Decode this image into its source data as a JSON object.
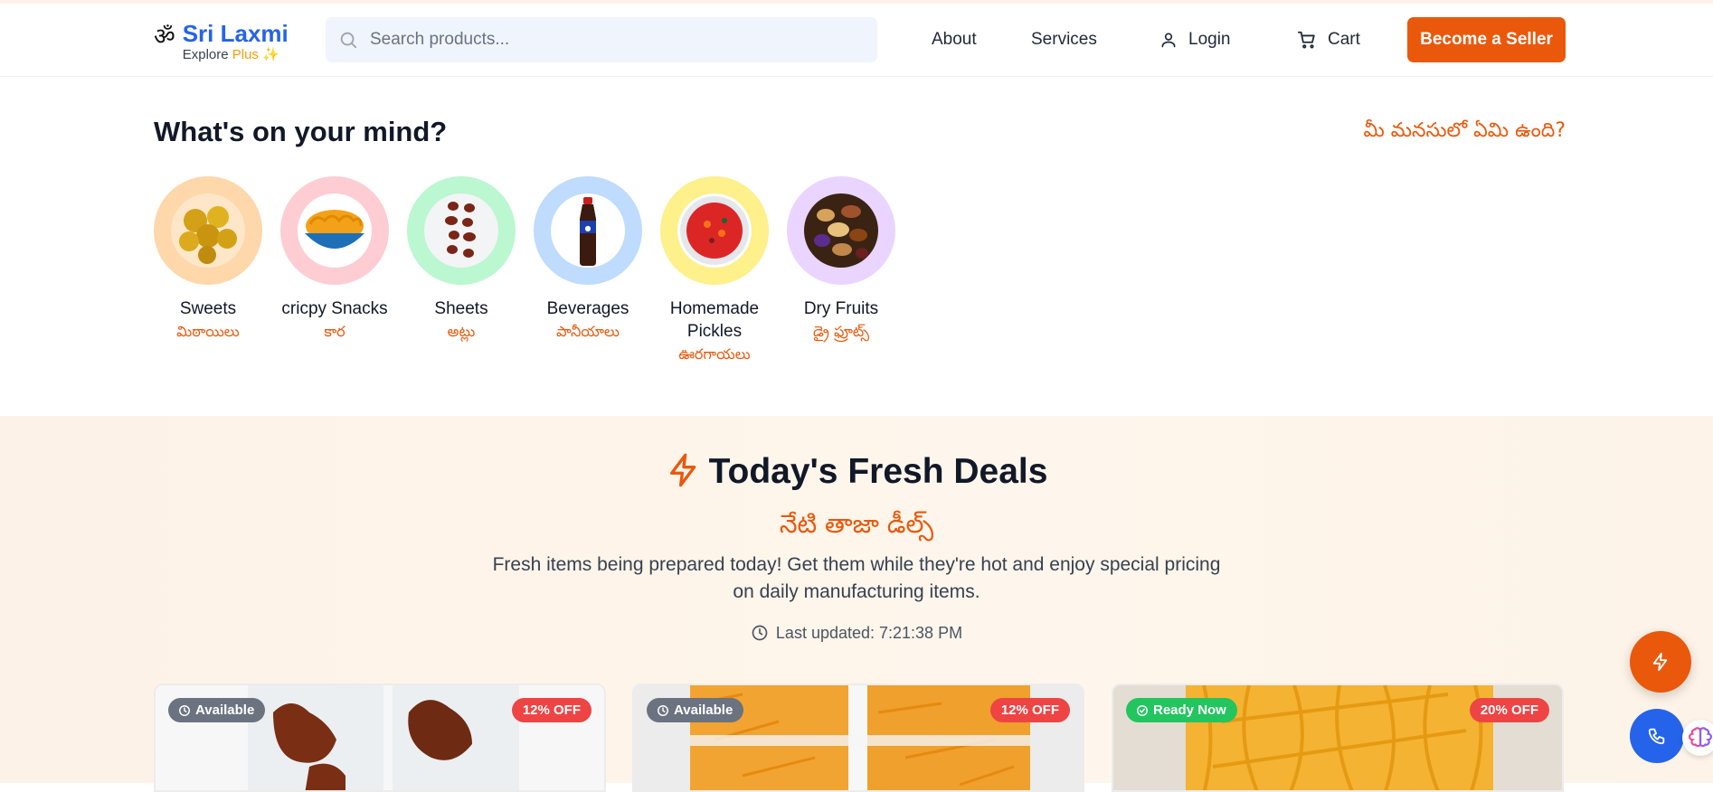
{
  "header": {
    "om": "ॐ",
    "brand": "Sri Laxmi",
    "tagline_prefix": "Explore",
    "tagline_plus": "Plus",
    "tagline_sparkle": "✨",
    "search_placeholder": "Search products...",
    "nav": {
      "about": "About",
      "services": "Services",
      "login": "Login",
      "cart": "Cart"
    },
    "seller_button": "Become a Seller"
  },
  "mind": {
    "title": "What's on your mind?",
    "title_te": "మీ మనసులో ఏమి ఉంది?",
    "categories": [
      {
        "name": "Sweets",
        "te": "మిఠాయిలు"
      },
      {
        "name": "cricpy Snacks",
        "te": "కార"
      },
      {
        "name": "Sheets",
        "te": "అట్లు"
      },
      {
        "name": "Beverages",
        "te": "పానీయాలు"
      },
      {
        "name": "Homemade Pickles",
        "te": "ఊరగాయలు"
      },
      {
        "name": "Dry Fruits",
        "te": "డ్రై ఫ్రూట్స్"
      }
    ]
  },
  "deals": {
    "title": "Today's Fresh Deals",
    "title_te": "నేటి తాజా డీల్స్",
    "description": "Fresh items being prepared today! Get them while they're hot and enjoy special pricing on daily manufacturing items.",
    "last_updated": "Last updated: 7:21:38 PM",
    "cards": [
      {
        "status": "Available",
        "discount": "12% OFF"
      },
      {
        "status": "Available",
        "discount": "12% OFF"
      },
      {
        "status": "Ready Now",
        "discount": "20% OFF"
      }
    ]
  },
  "colors": {
    "accent": "#ea580c",
    "brand": "#2563eb",
    "badge_gray": "#6b7280",
    "badge_green": "#22c55e",
    "discount": "#ef4444"
  }
}
